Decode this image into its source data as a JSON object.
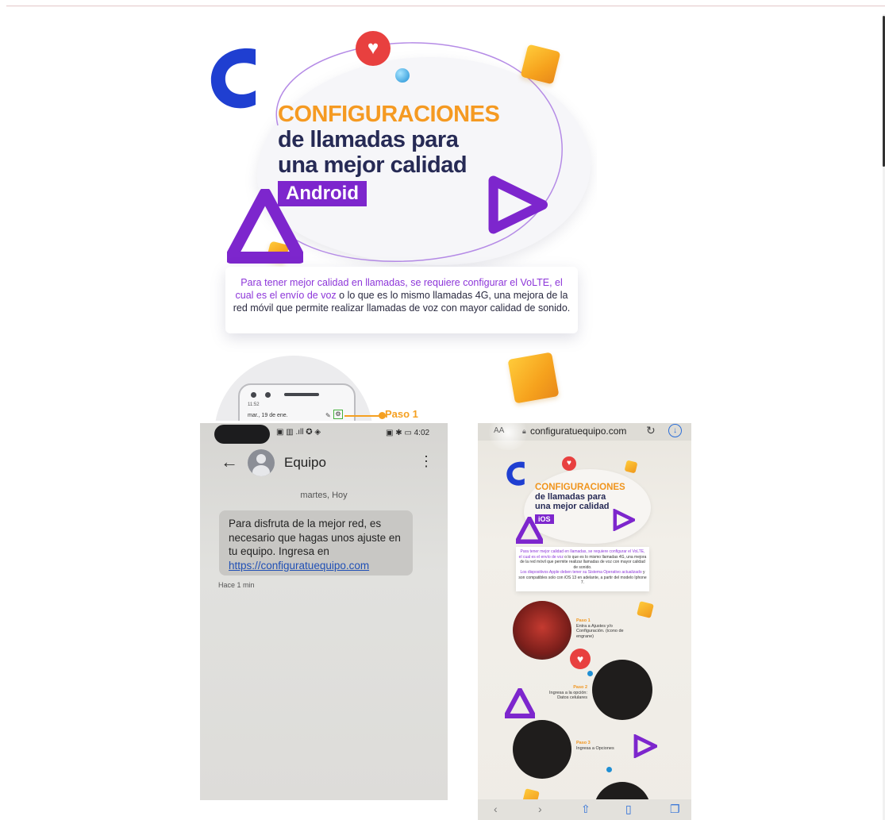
{
  "android_infographic": {
    "title": "CONFIGURACIONES",
    "subtitle_line1": "de llamadas para",
    "subtitle_line2": "una mejor calidad",
    "platform": "Android",
    "info_em": "Para tener mejor calidad en llamadas, se requiere configurar el VoLTE, el cual es el envío de voz",
    "info_rest": " o lo que es lo mismo llamadas 4G, una mejora de la red móvil que permite realizar llamadas de voz con mayor calidad de sonido.",
    "phone_time": "11:52",
    "phone_date": "mar., 19 de ene.",
    "step_label": "Paso 1",
    "icon": "heart-icon",
    "colors": {
      "orange": "#f59a22",
      "navy": "#262a55",
      "purple": "#7d26cd",
      "heart": "#e8403f"
    }
  },
  "sms_screenshot": {
    "status_left": "▣ ▥ .ıll ✪ ◈",
    "status_right": "▣ ✱ ▭ 4:02",
    "contact_name": "Equipo",
    "date_header": "martes, Hoy",
    "message_text": "Para disfruta de la mejor red, es necesario que hagas unos ajuste en tu equipo. Ingresa en",
    "message_link": "https://configuratuequipo.com",
    "message_time": "Hace 1 min",
    "icons": {
      "back": "back-arrow-icon",
      "avatar": "avatar-icon",
      "menu": "more-vertical-icon"
    }
  },
  "ios_screenshot": {
    "url_aa": "AA",
    "url": "configuratuequipo.com",
    "title": "CONFIGURACIONES",
    "subtitle_line1": "de llamadas para",
    "subtitle_line2": "una mejor calidad",
    "platform": "iOS",
    "info_em": "Para tener mejor calidad en llamadas, se requiere configurar el VoLTE, el cual es el envío de voz",
    "info_rest": " o lo que es lo mismo llamadas 4G, una mejora de la red móvil que permite realizar llamadas de voz con mayor calidad de sonido.",
    "info2_em": "Los dispositivos Apple deben tener su Sistema Operativo actualizado",
    "info2_rest": " y son compatibles solo con iOS 13 en adelante, a partir del modelo Iphone 7.",
    "step1_label": "Paso 1",
    "step1_text": "Entra a Ajustes y/o Configuración. (icono de engrane)",
    "step2_label": "Paso 2",
    "step2_text": "Ingresa a la opción: Datos celulares",
    "step3_label": "Paso 3",
    "step3_text": "Ingresa a Opciones",
    "toolbar_icons": [
      "back-icon",
      "forward-icon",
      "share-icon",
      "bookmarks-icon",
      "tabs-icon"
    ]
  }
}
